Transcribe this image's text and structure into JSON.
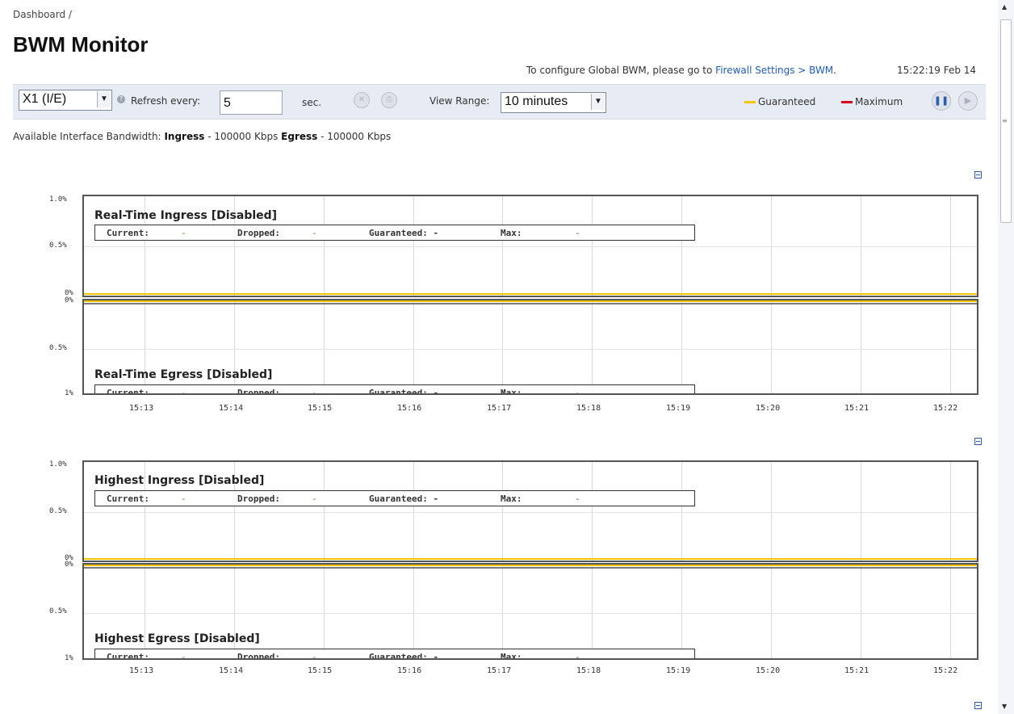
{
  "breadcrumb": "Dashboard /",
  "title": "BWM Monitor",
  "config_text": "To configure Global BWM, please go to ",
  "config_link": "Firewall Settings > BWM",
  "config_period": ".",
  "clock": "15:22:19 Feb 14",
  "toolbar": {
    "interface_value": "X1 (I/E)",
    "refresh_label": "Refresh every:",
    "refresh_value": "5",
    "sec_label": "sec.",
    "view_range_label": "View Range:",
    "view_range_value": "10 minutes",
    "legend_guaranteed": "Guaranteed",
    "legend_maximum": "Maximum",
    "color_guaranteed": "#f5c400",
    "color_maximum": "#d0021b"
  },
  "bandwidth": {
    "prefix": "Available Interface Bandwidth:",
    "ingress_label": "Ingress",
    "ingress_value": " - 100000 Kbps ",
    "egress_label": "Egress",
    "egress_value": " - 100000 Kbps"
  },
  "stats_labels": {
    "current": "Current:",
    "dropped": "Dropped:",
    "guaranteed": "Guaranteed: -",
    "max": "Max:",
    "dash": "-"
  },
  "charts": [
    {
      "ingress_title": "Real-Time Ingress [Disabled]",
      "egress_title": "Real-Time Egress [Disabled]",
      "y_top": [
        "1.0%",
        "0.5%",
        "0%"
      ],
      "y_bottom": [
        "0%",
        "0.5%",
        "1%"
      ],
      "x_ticks": [
        "15:13",
        "15:14",
        "15:15",
        "15:16",
        "15:17",
        "15:18",
        "15:19",
        "15:20",
        "15:21",
        "15:22"
      ]
    },
    {
      "ingress_title": "Highest Ingress [Disabled]",
      "egress_title": "Highest Egress [Disabled]",
      "y_top": [
        "1.0%",
        "0.5%",
        "0%"
      ],
      "y_bottom": [
        "0%",
        "0.5%",
        "1%"
      ],
      "x_ticks": [
        "15:13",
        "15:14",
        "15:15",
        "15:16",
        "15:17",
        "15:18",
        "15:19",
        "15:20",
        "15:21",
        "15:22"
      ]
    }
  ]
}
